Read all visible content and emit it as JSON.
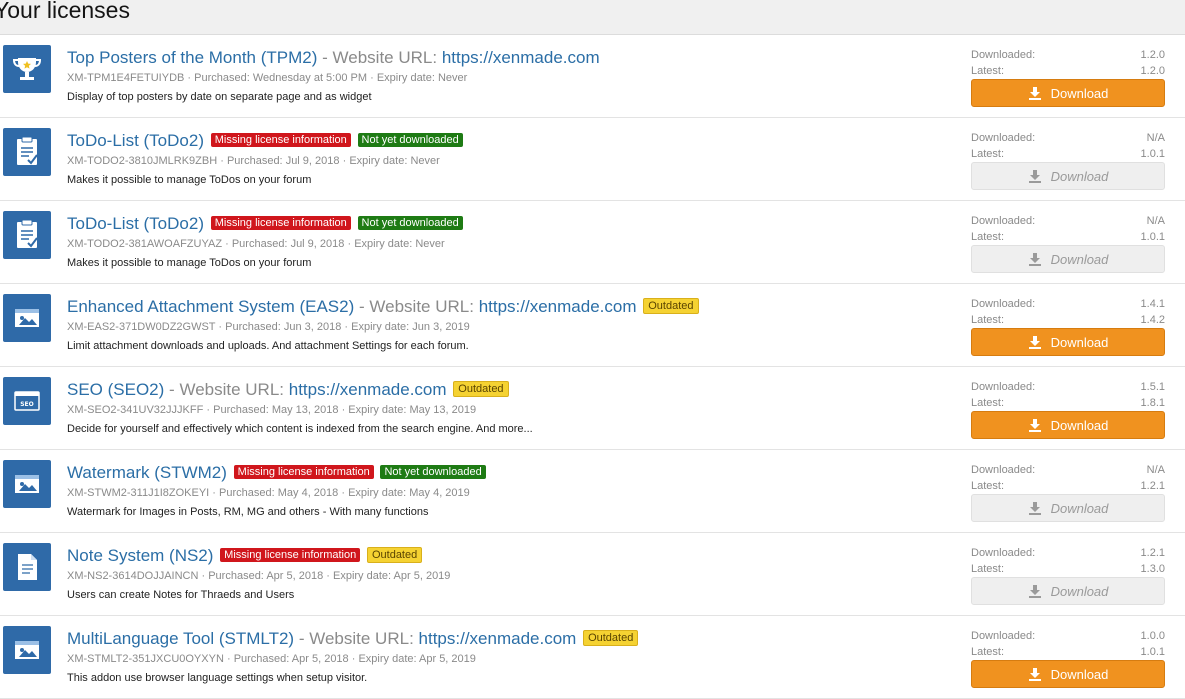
{
  "page_title": "Your licenses",
  "labels": {
    "url_label": "Website URL:",
    "purchased": "Purchased:",
    "expiry": "Expiry date:",
    "downloaded": "Downloaded:",
    "latest": "Latest:",
    "separator": "-",
    "bullet": "·"
  },
  "colors": {
    "accent_blue": "#2b6ea6",
    "download_orange": "#f0921f",
    "badge_red": "#d0161c",
    "badge_green": "#1e7b14",
    "badge_yellow": "#f5d232"
  },
  "licenses": [
    {
      "icon": "trophy-icon",
      "title": "Top Posters of the Month (TPM2)",
      "url": "https://xenmade.com",
      "badges": [],
      "license_key": "XM-TPM1E4FETUIYDB",
      "purchased": "Wednesday at 5:00 PM",
      "expiry": "Never",
      "description": "Display of top posters by date on separate page and as widget",
      "downloaded": "1.2.0",
      "latest": "1.2.0",
      "download_label": "Download",
      "download_enabled": true
    },
    {
      "icon": "clipboard-icon",
      "title": "ToDo-List (ToDo2)",
      "url": "",
      "badges": [
        {
          "text": "Missing license information",
          "type": "missing"
        },
        {
          "text": "Not yet downloaded",
          "type": "notdl"
        }
      ],
      "license_key": "XM-TODO2-3810JMLRK9ZBH",
      "purchased": "Jul 9, 2018",
      "expiry": "Never",
      "description": "Makes it possible to manage ToDos on your forum",
      "downloaded": "N/A",
      "latest": "1.0.1",
      "download_label": "Download",
      "download_enabled": false
    },
    {
      "icon": "clipboard-icon",
      "title": "ToDo-List (ToDo2)",
      "url": "",
      "badges": [
        {
          "text": "Missing license information",
          "type": "missing"
        },
        {
          "text": "Not yet downloaded",
          "type": "notdl"
        }
      ],
      "license_key": "XM-TODO2-381AWOAFZUYAZ",
      "purchased": "Jul 9, 2018",
      "expiry": "Never",
      "description": "Makes it possible to manage ToDos on your forum",
      "downloaded": "N/A",
      "latest": "1.0.1",
      "download_label": "Download",
      "download_enabled": false
    },
    {
      "icon": "attachment-window-icon",
      "title": "Enhanced Attachment System (EAS2)",
      "url": "https://xenmade.com",
      "badges": [
        {
          "text": "Outdated",
          "type": "outdated"
        }
      ],
      "license_key": "XM-EAS2-371DW0DZ2GWST",
      "purchased": "Jun 3, 2018",
      "expiry": "Jun 3, 2019",
      "description": "Limit attachment downloads and uploads. And attachment Settings for each forum.",
      "downloaded": "1.4.1",
      "latest": "1.4.2",
      "download_label": "Download",
      "download_enabled": true
    },
    {
      "icon": "seo-icon",
      "title": "SEO (SEO2)",
      "url": "https://xenmade.com",
      "badges": [
        {
          "text": "Outdated",
          "type": "outdated"
        }
      ],
      "license_key": "XM-SEO2-341UV32JJJKFF",
      "purchased": "May 13, 2018",
      "expiry": "May 13, 2019",
      "description": "Decide for yourself and effectively which content is indexed from the search engine. And more...",
      "downloaded": "1.5.1",
      "latest": "1.8.1",
      "download_label": "Download",
      "download_enabled": true
    },
    {
      "icon": "watermark-window-icon",
      "title": "Watermark (STWM2)",
      "url": "",
      "badges": [
        {
          "text": "Missing license information",
          "type": "missing"
        },
        {
          "text": "Not yet downloaded",
          "type": "notdl"
        }
      ],
      "license_key": "XM-STWM2-311J1I8ZOKEYI",
      "purchased": "May 4, 2018",
      "expiry": "May 4, 2019",
      "description": "Watermark for Images in Posts, RM, MG and others - With many functions",
      "downloaded": "N/A",
      "latest": "1.2.1",
      "download_label": "Download",
      "download_enabled": false
    },
    {
      "icon": "note-icon",
      "title": "Note System (NS2)",
      "url": "",
      "badges": [
        {
          "text": "Missing license information",
          "type": "missing"
        },
        {
          "text": "Outdated",
          "type": "outdated"
        }
      ],
      "license_key": "XM-NS2-3614DOJJAINCN",
      "purchased": "Apr 5, 2018",
      "expiry": "Apr 5, 2019",
      "description": "Users can create Notes for Thraeds and Users",
      "downloaded": "1.2.1",
      "latest": "1.3.0",
      "download_label": "Download",
      "download_enabled": false
    },
    {
      "icon": "language-window-icon",
      "title": "MultiLanguage Tool (STMLT2)",
      "url": "https://xenmade.com",
      "badges": [
        {
          "text": "Outdated",
          "type": "outdated"
        }
      ],
      "license_key": "XM-STMLT2-351JXCU0OYXYN",
      "purchased": "Apr 5, 2018",
      "expiry": "Apr 5, 2019",
      "description": "This addon use browser language settings when setup visitor.",
      "downloaded": "1.0.0",
      "latest": "1.0.1",
      "download_label": "Download",
      "download_enabled": true
    }
  ]
}
